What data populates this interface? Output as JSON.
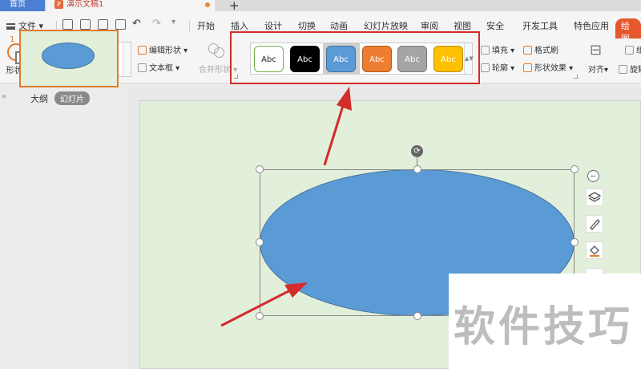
{
  "tabs": {
    "home": "首页",
    "document": "演示文稿1",
    "new_tab": "+"
  },
  "menu": {
    "file": "文件",
    "items": [
      "开始",
      "插入",
      "设计",
      "切换",
      "动画",
      "幻灯片放映",
      "审阅",
      "视图",
      "安全",
      "开发工具",
      "特色应用"
    ],
    "special": "绘图"
  },
  "ribbon": {
    "shape": "形状",
    "edit_shape": "编辑形状",
    "text_box": "文本框",
    "merge_shape": "合并形状",
    "style_swatches": [
      {
        "label": "Abc",
        "bg": "#ffffff",
        "fg": "#222222",
        "border": "#70ad47"
      },
      {
        "label": "Abc",
        "bg": "#000000",
        "fg": "#ffffff",
        "border": "#000000"
      },
      {
        "label": "Abc",
        "bg": "#5b9bd5",
        "fg": "#ffffff",
        "border": "#41719c"
      },
      {
        "label": "Abc",
        "bg": "#ed7d31",
        "fg": "#ffffff",
        "border": "#ae5a21"
      },
      {
        "label": "Abc",
        "bg": "#a5a5a5",
        "fg": "#ffffff",
        "border": "#787878"
      },
      {
        "label": "Abc",
        "bg": "#ffc000",
        "fg": "#ffffff",
        "border": "#bc8c00"
      }
    ],
    "fill": "填充",
    "format_painter": "格式刷",
    "outline": "轮廓",
    "shape_effects": "形状效果",
    "align": "对齐",
    "rotate": "旋转",
    "group": "组"
  },
  "left_pane": {
    "outline_tab": "大纲",
    "slides_tab": "幻灯片",
    "slide_number": "1"
  },
  "colors": {
    "accent": "#e07a2c",
    "shape_fill": "#5b9bd5",
    "slide_bg": "#e2efda",
    "annotation_red": "#d42b2b"
  },
  "watermark": "软件技巧"
}
